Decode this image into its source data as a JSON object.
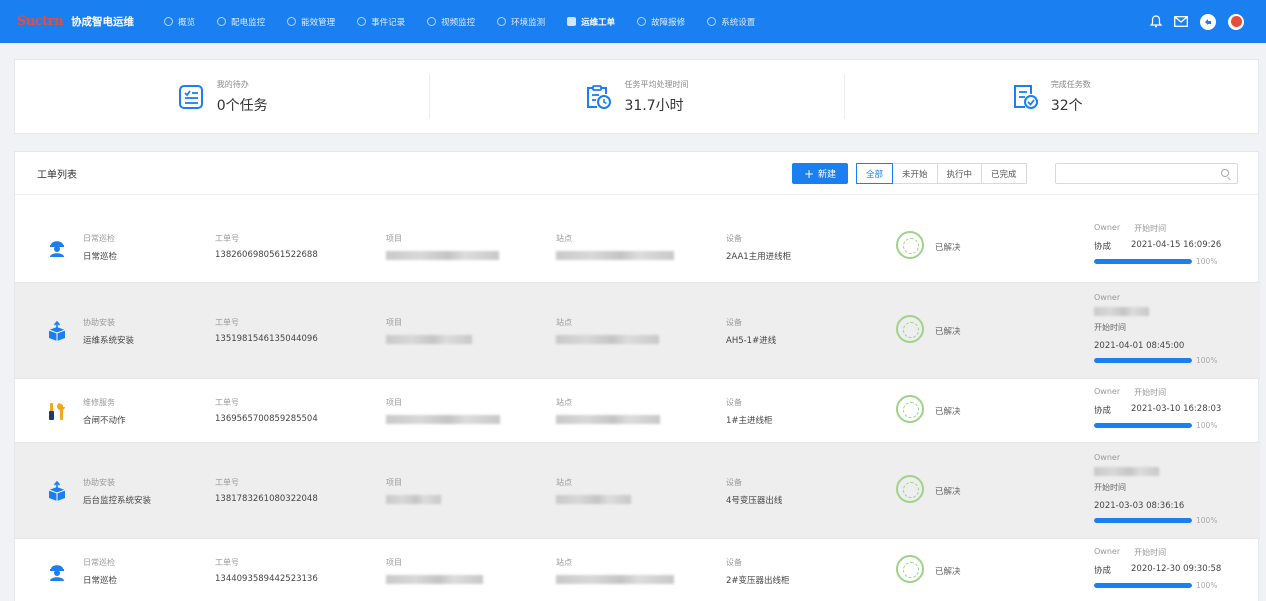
{
  "header": {
    "logo_text": "Suctrn",
    "app_title": "协成智电运维",
    "nav": [
      {
        "label": "概览",
        "icon": "dashboard-icon",
        "active": false
      },
      {
        "label": "配电监控",
        "icon": "monitor-icon",
        "active": false
      },
      {
        "label": "能效管理",
        "icon": "chart-icon",
        "active": false
      },
      {
        "label": "事件记录",
        "icon": "record-icon",
        "active": false
      },
      {
        "label": "视频监控",
        "icon": "camera-icon",
        "active": false
      },
      {
        "label": "环境监测",
        "icon": "environment-icon",
        "active": false
      },
      {
        "label": "运维工单",
        "icon": "workorder-icon",
        "active": true
      },
      {
        "label": "故障报修",
        "icon": "repair-icon",
        "active": false
      },
      {
        "label": "系统设置",
        "icon": "settings-icon",
        "active": false
      }
    ]
  },
  "stats": [
    {
      "label": "我的待办",
      "value": "0个任务",
      "icon": "todo-list-icon"
    },
    {
      "label": "任务平均处理时间",
      "value": "31.7小时",
      "icon": "clock-clipboard-icon"
    },
    {
      "label": "完成任务数",
      "value": "32个",
      "icon": "completed-task-icon"
    }
  ],
  "list": {
    "title": "工单列表",
    "new_button": "新建",
    "filters": [
      "全部",
      "未开始",
      "执行中",
      "已完成"
    ],
    "active_filter": "全部",
    "search_placeholder": "",
    "labels": {
      "order_no": "工单号",
      "project": "项目",
      "station": "站点",
      "device": "设备",
      "owner": "Owner",
      "start_time": "开始时间"
    },
    "rows": [
      {
        "category": "日常巡检",
        "name": "日常巡检",
        "icon": "worker-icon",
        "order_no": "1382606980561522688",
        "device": "2AA1主用进线柜",
        "status": "已解决",
        "owner": "协成",
        "start_time": "2021-04-15 16:09:26",
        "progress": 100,
        "progress_label": "100%"
      },
      {
        "category": "协助安装",
        "name": "运维系统安装",
        "icon": "install-box-icon",
        "order_no": "1351981546135044096",
        "device": "AH5-1#进线",
        "status": "已解决",
        "owner": "",
        "start_time": "2021-04-01 08:45:00",
        "progress": 100,
        "progress_label": "100%"
      },
      {
        "category": "维修服务",
        "name": "合闸不动作",
        "icon": "repair-tools-icon",
        "order_no": "1369565700859285504",
        "device": "1#主进线柜",
        "status": "已解决",
        "owner": "协成",
        "start_time": "2021-03-10 16:28:03",
        "progress": 100,
        "progress_label": "100%"
      },
      {
        "category": "协助安装",
        "name": "后台监控系统安装",
        "icon": "install-box-icon",
        "order_no": "1381783261080322048",
        "device": "4号变压器出线",
        "status": "已解决",
        "owner": "",
        "start_time": "2021-03-03 08:36:16",
        "progress": 100,
        "progress_label": "100%"
      },
      {
        "category": "日常巡检",
        "name": "日常巡检",
        "icon": "worker-icon",
        "order_no": "1344093589442523136",
        "device": "2#变压器出线柜",
        "status": "已解决",
        "owner": "协成",
        "start_time": "2020-12-30 09:30:58",
        "progress": 100,
        "progress_label": "100%"
      }
    ]
  },
  "colors": {
    "primary": "#1a7ff0",
    "logo": "#e84c3d",
    "stamp": "#9fd28a"
  }
}
